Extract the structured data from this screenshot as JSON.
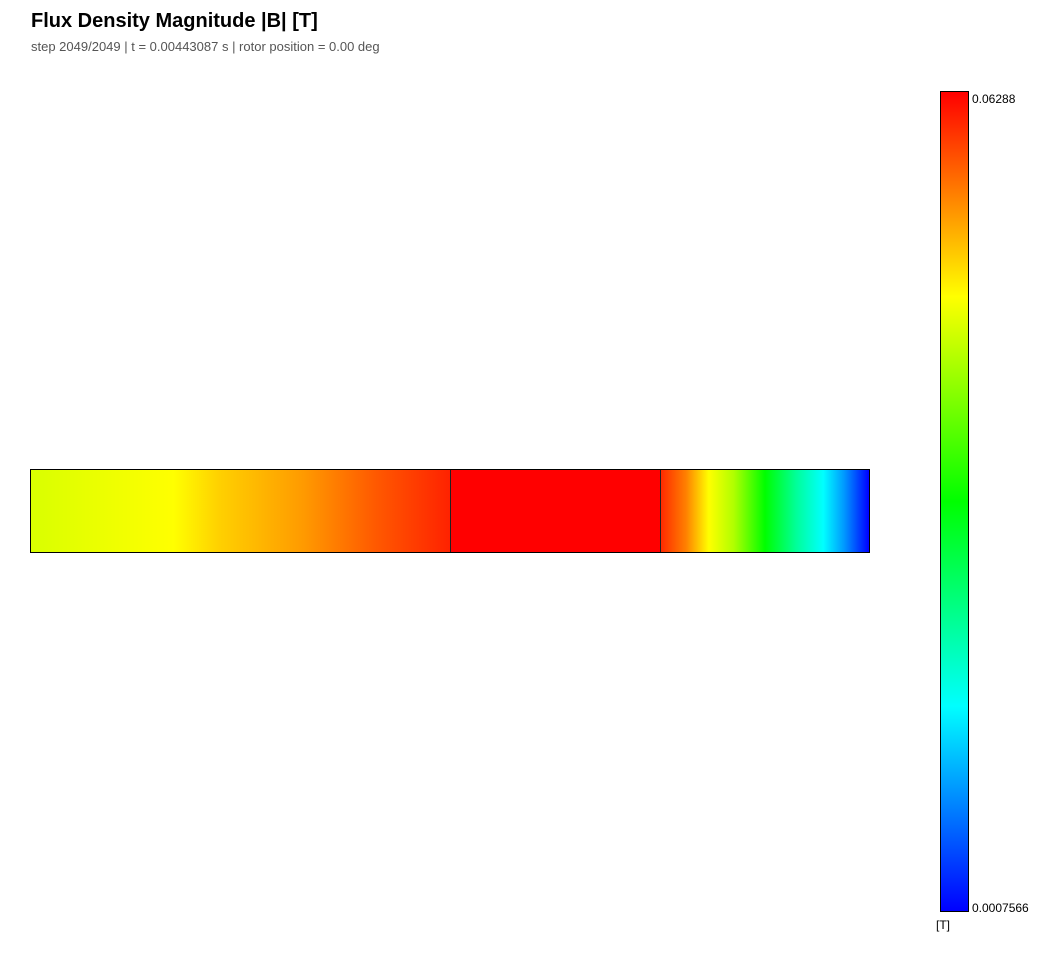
{
  "header": {
    "title": "Flux Density Magnitude |B|  [T]",
    "subtitle": "step 2049/2049  |  t = 0.00443087 s  |  rotor position = 0.00 deg"
  },
  "colorbar": {
    "max_label": "0.06288",
    "min_label": "0.0007566",
    "unit": "[T]",
    "colors": [
      "#ff0000",
      "#ffff00",
      "#00ff00",
      "#00ffff",
      "#0000ff"
    ]
  },
  "field": {
    "regions": 3
  }
}
